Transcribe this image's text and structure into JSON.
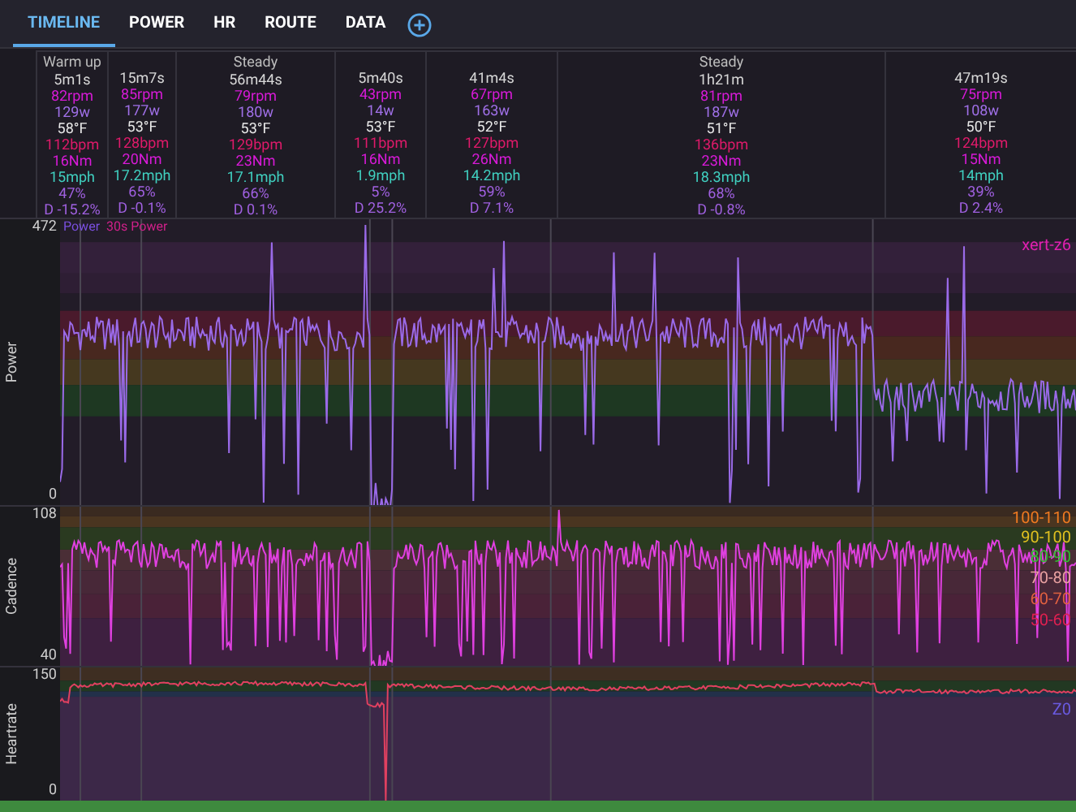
{
  "tabs": [
    {
      "label": "TIMELINE",
      "selected": true
    },
    {
      "label": "POWER",
      "selected": false
    },
    {
      "label": "HR",
      "selected": false
    },
    {
      "label": "ROUTE",
      "selected": false
    },
    {
      "label": "DATA",
      "selected": false
    }
  ],
  "segments": [
    {
      "title": "Warm up",
      "duration": "5m1s",
      "cadence": "82rpm",
      "power": "129w",
      "temp": "58°F",
      "hr": "112bpm",
      "torque": "16Nm",
      "speed": "15mph",
      "pct": "47%",
      "delta": "D -15.2%"
    },
    {
      "duration": "15m7s",
      "cadence": "85rpm",
      "power": "177w",
      "temp": "53°F",
      "hr": "128bpm",
      "torque": "20Nm",
      "speed": "17.2mph",
      "pct": "65%",
      "delta": "D -0.1%"
    },
    {
      "title": "Steady",
      "duration": "56m44s",
      "cadence": "79rpm",
      "power": "180w",
      "temp": "53°F",
      "hr": "129bpm",
      "torque": "23Nm",
      "speed": "17.1mph",
      "pct": "66%",
      "delta": "D 0.1%"
    },
    {
      "duration": "5m40s",
      "cadence": "43rpm",
      "power": "14w",
      "temp": "53°F",
      "hr": "111bpm",
      "torque": "16Nm",
      "speed": "1.9mph",
      "pct": "5%",
      "delta": "D 25.2%"
    },
    {
      "duration": "41m4s",
      "cadence": "67rpm",
      "power": "163w",
      "temp": "52°F",
      "hr": "127bpm",
      "torque": "26Nm",
      "speed": "14.2mph",
      "pct": "59%",
      "delta": "D 7.1%"
    },
    {
      "title": "Steady",
      "duration": "1h21m",
      "cadence": "81rpm",
      "power": "187w",
      "temp": "51°F",
      "hr": "136bpm",
      "torque": "23Nm",
      "speed": "18.3mph",
      "pct": "68%",
      "delta": "D -0.8%"
    },
    {
      "duration": "47m19s",
      "cadence": "75rpm",
      "power": "108w",
      "temp": "50°F",
      "hr": "124bpm",
      "torque": "15Nm",
      "speed": "14mph",
      "pct": "39%",
      "delta": "D 2.4%"
    }
  ],
  "charts": [
    {
      "kind": "power",
      "ylabel": "Power",
      "ymax": "472",
      "ymin": "0",
      "legend": [
        {
          "label": "Power",
          "color": "#7b4fe0"
        },
        {
          "label": "30s Power",
          "color": "#d0208a"
        }
      ],
      "zones": [
        {
          "label": "xert-z6",
          "color": "#e020b0"
        }
      ]
    },
    {
      "kind": "cadence",
      "ylabel": "Cadence",
      "ymax": "108",
      "ymin": "40",
      "zones": [
        {
          "label": "100-110",
          "color": "#f07a20"
        },
        {
          "label": "90-100",
          "color": "#e0c020"
        },
        {
          "label": "80-90",
          "color": "#30c030"
        },
        {
          "label": "70-80",
          "color": "#e8a0a0"
        },
        {
          "label": "60-70",
          "color": "#e06040"
        },
        {
          "label": "50-60",
          "color": "#e02050"
        }
      ]
    },
    {
      "kind": "heartrate",
      "ylabel": "Heartrate",
      "ymax": "150",
      "ymin": "0",
      "zones": [
        {
          "label": "Z0",
          "color": "#6a5ae0"
        }
      ]
    }
  ]
}
